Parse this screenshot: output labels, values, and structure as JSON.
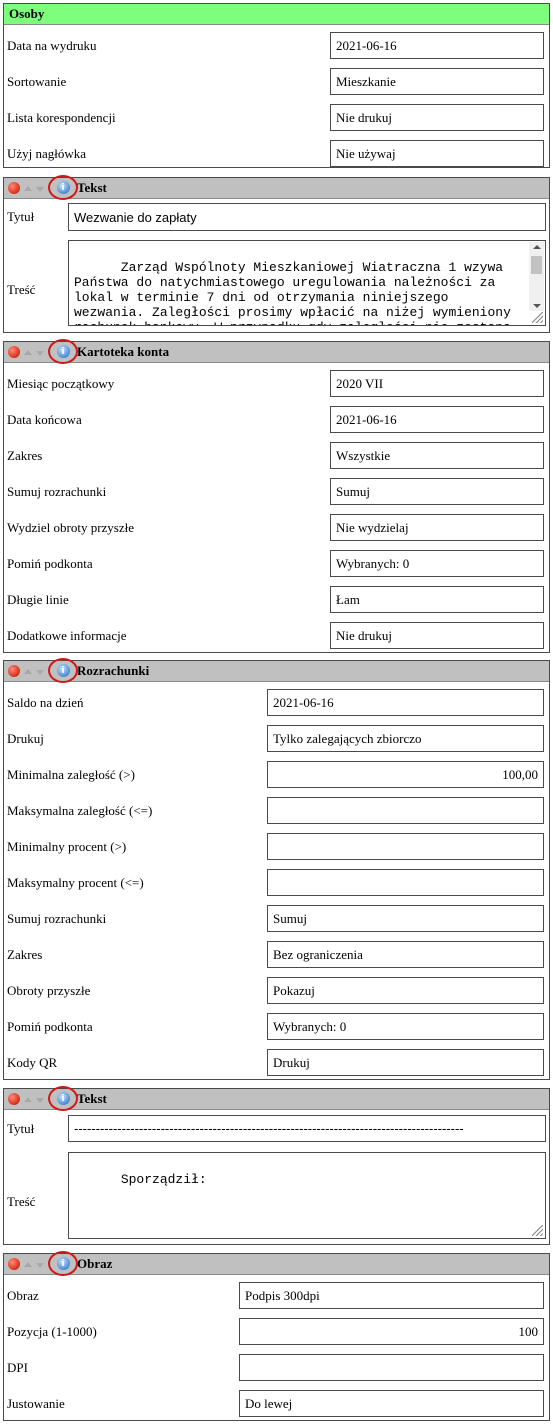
{
  "osoby": {
    "title": "Osoby",
    "rows": [
      {
        "label": "Data na wydruku",
        "value": "2021-06-16"
      },
      {
        "label": "Sortowanie",
        "value": "Mieszkanie"
      },
      {
        "label": "Lista korespondencji",
        "value": "Nie drukuj"
      },
      {
        "label": "Użyj nagłówka",
        "value": "Nie używaj"
      }
    ]
  },
  "tekst1": {
    "title": "Tekst",
    "tytul_label": "Tytuł",
    "tytul_value": "Wezwanie do zapłaty",
    "tresc_label": "Treść",
    "tresc_value": "Zarząd Wspólnoty Mieszkaniowej Wiatraczna 1 wzywa Państwa do natychmiastowego uregulowania należności za lokal w terminie 7 dni od otrzymania niniejszego wezwania. Zaległości prosimy wpłacić na niżej wymieniony rachunek bankowy. W przypadku gdy zaległości nie zostaną"
  },
  "kartoteka": {
    "title": "Kartoteka konta",
    "rows": [
      {
        "label": "Miesiąc początkowy",
        "value": "2020 VII"
      },
      {
        "label": "Data końcowa",
        "value": "2021-06-16"
      },
      {
        "label": "Zakres",
        "value": "Wszystkie"
      },
      {
        "label": "Sumuj rozrachunki",
        "value": "Sumuj"
      },
      {
        "label": "Wydziel obroty przyszłe",
        "value": "Nie wydzielaj"
      },
      {
        "label": "Pomiń podkonta",
        "value": "Wybranych: 0"
      },
      {
        "label": "Długie linie",
        "value": "Łam"
      },
      {
        "label": "Dodatkowe informacje",
        "value": "Nie drukuj"
      }
    ]
  },
  "rozrachunki": {
    "title": "Rozrachunki",
    "rows": [
      {
        "label": "Saldo na dzień",
        "value": "2021-06-16"
      },
      {
        "label": "Drukuj",
        "value": "Tylko zalegających zbiorczo"
      },
      {
        "label": "Minimalna zaległość (>)",
        "value": "100,00"
      },
      {
        "label": "Maksymalna zaległość (<=)",
        "value": ""
      },
      {
        "label": "Minimalny procent (>)",
        "value": ""
      },
      {
        "label": "Maksymalny procent (<=)",
        "value": ""
      },
      {
        "label": "Sumuj rozrachunki",
        "value": "Sumuj"
      },
      {
        "label": "Zakres",
        "value": "Bez ograniczenia"
      },
      {
        "label": "Obroty przyszłe",
        "value": "Pokazuj"
      },
      {
        "label": "Pomiń podkonta",
        "value": "Wybranych: 0"
      },
      {
        "label": "Kody QR",
        "value": "Drukuj"
      }
    ]
  },
  "tekst2": {
    "title": "Tekst",
    "tytul_label": "Tytuł",
    "tytul_value": "------------------------------------------------------------------------------------------",
    "tresc_label": "Treść",
    "tresc_value": "Sporządził:"
  },
  "obraz": {
    "title": "Obraz",
    "rows": [
      {
        "label": "Obraz",
        "value": "Podpis 300dpi"
      },
      {
        "label": "Pozycja (1-1000)",
        "value": "100"
      },
      {
        "label": "DPI",
        "value": ""
      },
      {
        "label": "Justowanie",
        "value": "Do lewej"
      }
    ]
  },
  "icons": {
    "remove": "remove-red-dot-icon",
    "up": "move-up-icon",
    "down": "move-down-icon",
    "info": "info-icon"
  },
  "colors": {
    "green_header": "#7dff7d",
    "gray_header": "#c0c0c0",
    "highlight_circle": "#d01818"
  }
}
